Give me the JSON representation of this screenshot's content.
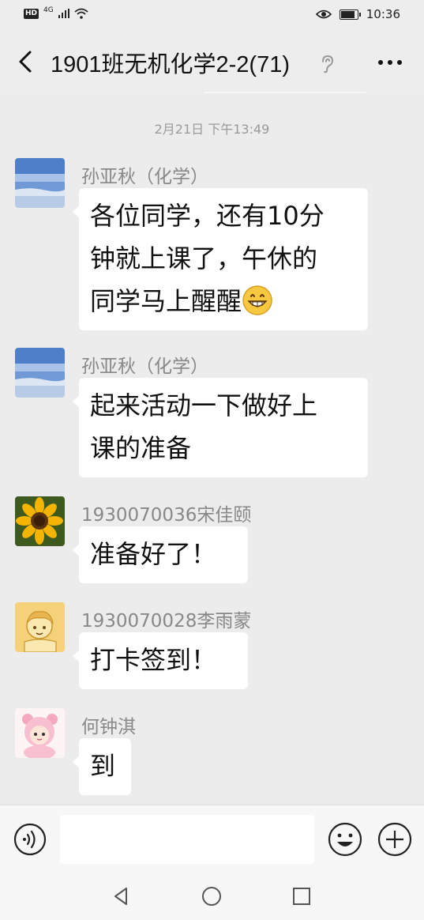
{
  "status_bar": {
    "left_badge": "HD",
    "network": "4G",
    "time": "10:36"
  },
  "header": {
    "title": "1901班无机化学2-2(71)",
    "back_icon": "chevron-left-icon",
    "ear_icon": "ear-icon",
    "more_icon": "more-icon"
  },
  "chat": {
    "timestamp": "2月21日 下午13:49",
    "messages": [
      {
        "sender": "孙亚秋（化学）",
        "lines": [
          "各位同学，还有10分",
          "钟就上课了，午休的",
          "同学马上醒醒"
        ],
        "emoji": "grinning-face",
        "avatar": "seascape-avatar"
      },
      {
        "sender": "孙亚秋（化学）",
        "lines": [
          "起来活动一下做好上",
          "课的准备"
        ],
        "avatar": "seascape-avatar"
      },
      {
        "sender": "1930070036宋佳颐",
        "lines": [
          "准备好了！"
        ],
        "avatar": "sunflower-avatar"
      },
      {
        "sender": "1930070028李雨蒙",
        "lines": [
          "打卡签到！"
        ],
        "avatar": "cartoon-avatar"
      },
      {
        "sender": "何钟淇",
        "lines": [
          "到"
        ],
        "avatar": "pink-bear-avatar"
      }
    ]
  },
  "input_bar": {
    "placeholder": "",
    "voice_icon": "voice-icon",
    "emoji_icon": "emoji-icon",
    "plus_icon": "plus-icon"
  },
  "colors": {
    "background": "#ececec",
    "bubble": "#ffffff",
    "sender_text": "#888888"
  }
}
